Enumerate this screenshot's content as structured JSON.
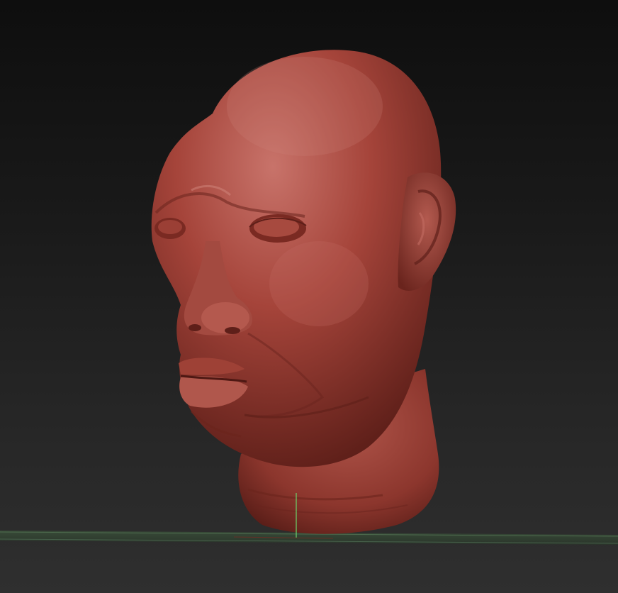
{
  "viewport": {
    "background_top": "#0e0e0e",
    "background_bottom": "#2f2f2f"
  },
  "model": {
    "material_color": "#a5443a",
    "highlight_color": "#c8736a",
    "shadow_color": "#5e1f19"
  },
  "floor_grid": {
    "color": "#3f5a3f",
    "axis_color": "#6bd46b"
  }
}
